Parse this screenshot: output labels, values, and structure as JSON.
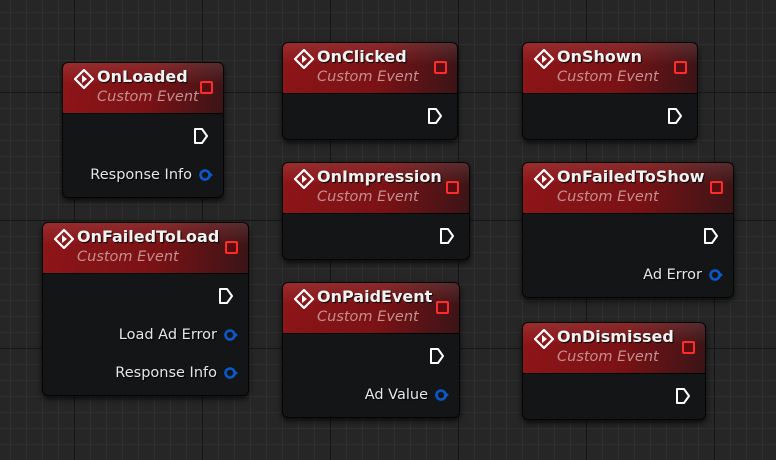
{
  "colors": {
    "header_red": "#8e1518",
    "delegate_pin": "#ff2b2b",
    "struct_pin": "#0a58c9",
    "subtitle": "#c48f8f",
    "grid_background": "#262626"
  },
  "icons": {
    "event": "event-diamond-icon",
    "exec_pin": "exec-output-pin-icon",
    "delegate_pin": "delegate-pin-icon",
    "data_pin": "struct-data-pin-icon"
  },
  "nodes": {
    "on_loaded": {
      "title": "OnLoaded",
      "subtitle": "Custom Event",
      "pins": [
        "Response Info"
      ]
    },
    "on_failed_to_load": {
      "title": "OnFailedToLoad",
      "subtitle": "Custom Event",
      "pins": [
        "Load Ad Error",
        "Response Info"
      ]
    },
    "on_clicked": {
      "title": "OnClicked",
      "subtitle": "Custom Event",
      "pins": []
    },
    "on_impression": {
      "title": "OnImpression",
      "subtitle": "Custom Event",
      "pins": []
    },
    "on_paid_event": {
      "title": "OnPaidEvent",
      "subtitle": "Custom Event",
      "pins": [
        "Ad Value"
      ]
    },
    "on_shown": {
      "title": "OnShown",
      "subtitle": "Custom Event",
      "pins": []
    },
    "on_failed_to_show": {
      "title": "OnFailedToShow",
      "subtitle": "Custom Event",
      "pins": [
        "Ad Error"
      ]
    },
    "on_dismissed": {
      "title": "OnDismissed",
      "subtitle": "Custom Event",
      "pins": []
    }
  }
}
